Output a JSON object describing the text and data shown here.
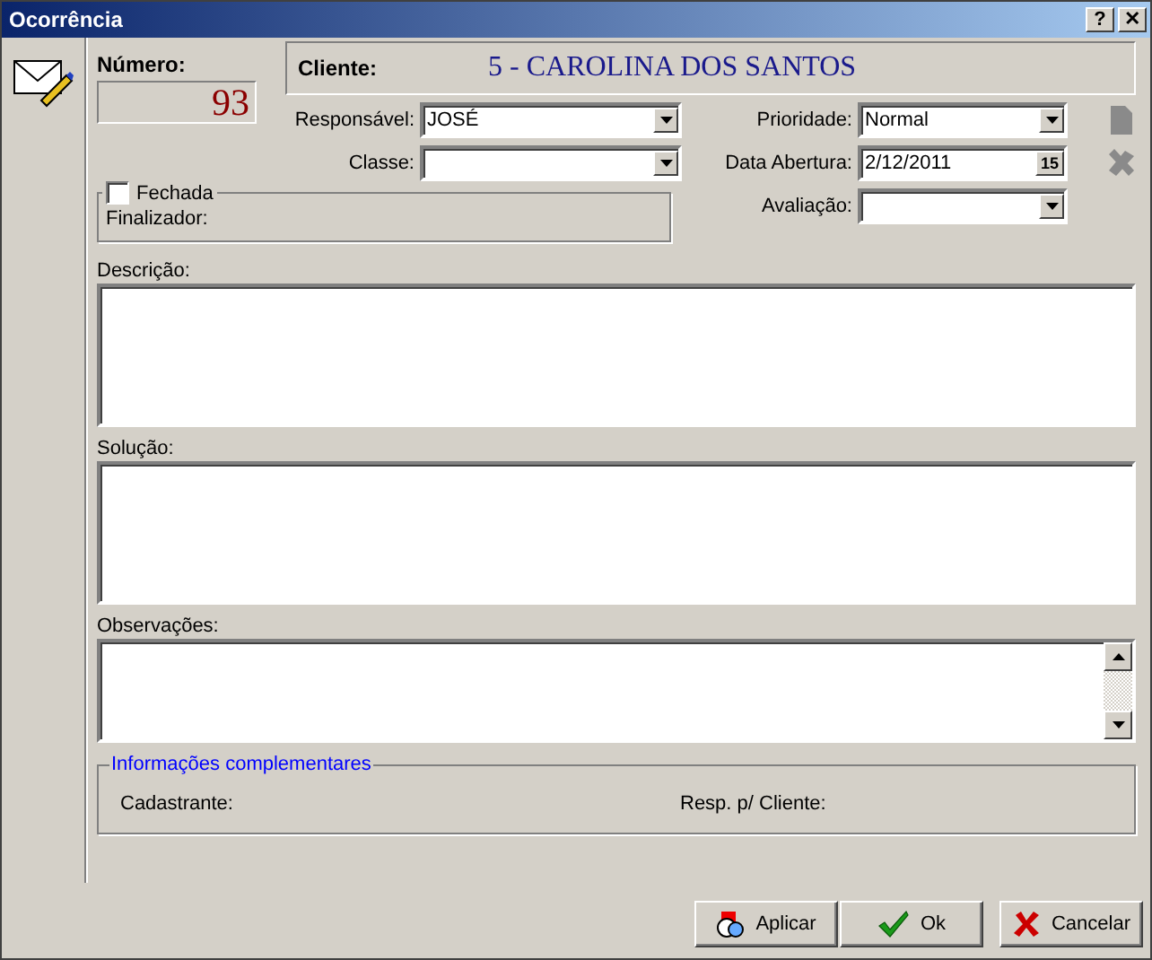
{
  "window": {
    "title": "Ocorrência",
    "controls": [
      {
        "kind": "help",
        "label": "?"
      },
      {
        "kind": "close",
        "label": "✕"
      }
    ]
  },
  "numero": {
    "label": "Número:",
    "value": "93"
  },
  "cliente": {
    "label": "Cliente:",
    "value": "5 - CAROLINA DOS SANTOS"
  },
  "left_fields": [
    {
      "label": "Responsável:",
      "value": "JOSÉ",
      "kind": "combo"
    },
    {
      "label": "Classe:",
      "kind": "combo"
    }
  ],
  "right_fields": [
    {
      "label": "Prioridade:",
      "value": "Normal",
      "kind": "combo"
    },
    {
      "label": "Data Abertura:",
      "value": "2/12/2011",
      "kind": "date",
      "button": "15"
    },
    {
      "label": "Avaliação:",
      "kind": "combo"
    }
  ],
  "fechada": {
    "label": "Fechada",
    "checked": false,
    "finalizador": "Finalizador:"
  },
  "memos": [
    {
      "label": "Descrição:",
      "kind": "plain"
    },
    {
      "label": "Solução:",
      "kind": "plain"
    },
    {
      "label": "Observações:",
      "kind": "scrolling"
    }
  ],
  "info": {
    "title": "Informações complementares",
    "cadastrante": "Cadastrante:",
    "resp_cliente": "Resp. p/ Cliente:"
  },
  "buttons": [
    {
      "label": "Aplicar",
      "kind": "apply"
    },
    {
      "label": "Ok",
      "kind": "ok"
    },
    {
      "label": "Cancelar",
      "kind": "cancel"
    }
  ]
}
